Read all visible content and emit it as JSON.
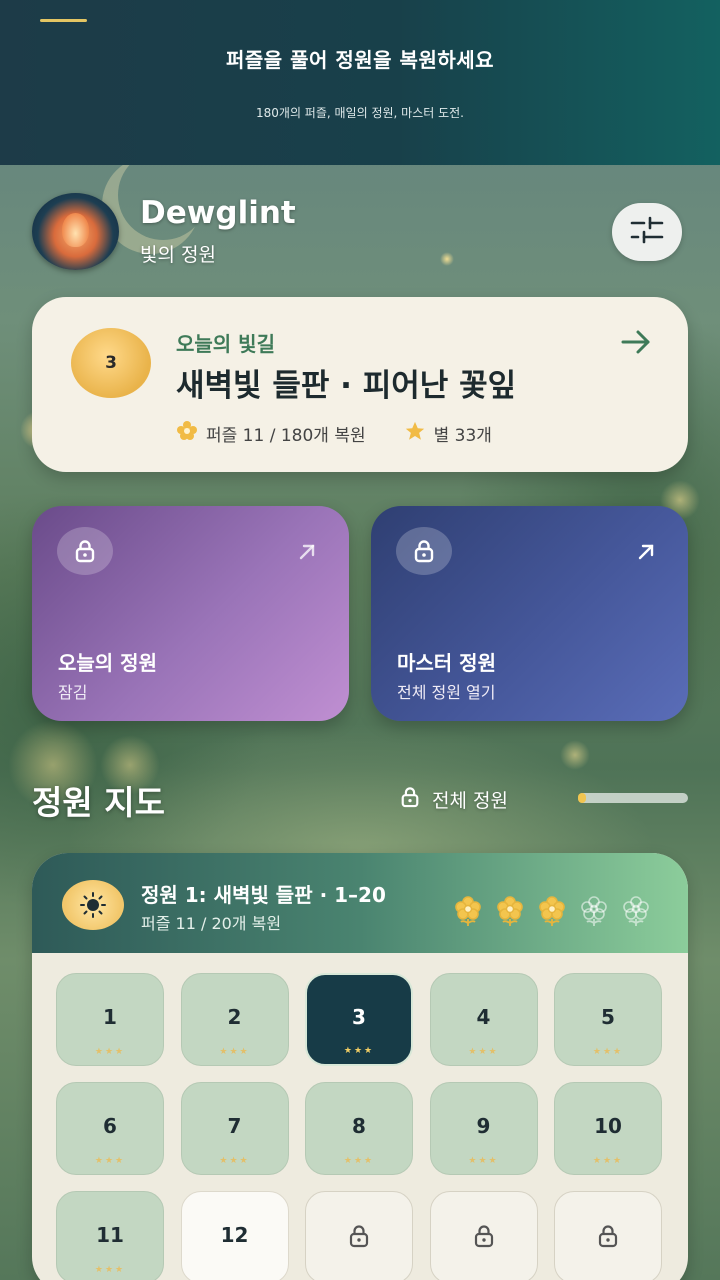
{
  "banner": {
    "title": "퍼즐을 풀어 정원을 복원하세요",
    "subtitle": "180개의 퍼즐, 매일의 정원, 마스터 도전."
  },
  "profile": {
    "name": "Dewglint",
    "garden_name": "빛의 정원",
    "settings_icon": "sliders-icon"
  },
  "today": {
    "badge_number": "3",
    "label": "오늘의 빛길",
    "puzzle_name": "새벽빛 들판 · 피어난 꽃잎",
    "puzzles_text": "퍼즐 11 / 180개 복원",
    "stars_text": "별 33개",
    "accent_color": "#3e7a58"
  },
  "modes": {
    "daily": {
      "title": "오늘의 정원",
      "status": "잠김",
      "icon": "lock-icon"
    },
    "master": {
      "title": "마스터 정원",
      "status": "전체 정원 열기",
      "icon": "lock-icon"
    }
  },
  "map": {
    "title": "정원 지도",
    "all_gardens_label": "전체 정원",
    "scroll_progress": 0.06
  },
  "garden": {
    "title": "정원 1: 새벽빛 들판 · 1–20",
    "progress_text": "퍼즐 11 / 20개 복원",
    "flowers_total": 5,
    "flowers_bloomed": 3,
    "levels": [
      {
        "n": "1",
        "state": "done",
        "stars": "★★★"
      },
      {
        "n": "2",
        "state": "done",
        "stars": "★★★"
      },
      {
        "n": "3",
        "state": "current",
        "stars": "★★★"
      },
      {
        "n": "4",
        "state": "done",
        "stars": "★★★"
      },
      {
        "n": "5",
        "state": "done",
        "stars": "★★★"
      },
      {
        "n": "6",
        "state": "done",
        "stars": "★★★"
      },
      {
        "n": "7",
        "state": "done",
        "stars": "★★★"
      },
      {
        "n": "8",
        "state": "done",
        "stars": "★★★"
      },
      {
        "n": "9",
        "state": "done",
        "stars": "★★★"
      },
      {
        "n": "10",
        "state": "done",
        "stars": "★★★"
      },
      {
        "n": "11",
        "state": "done",
        "stars": "★★★"
      },
      {
        "n": "12",
        "state": "open",
        "stars": ""
      },
      {
        "n": "",
        "state": "locked",
        "stars": ""
      },
      {
        "n": "",
        "state": "locked",
        "stars": ""
      },
      {
        "n": "",
        "state": "locked",
        "stars": ""
      }
    ]
  }
}
